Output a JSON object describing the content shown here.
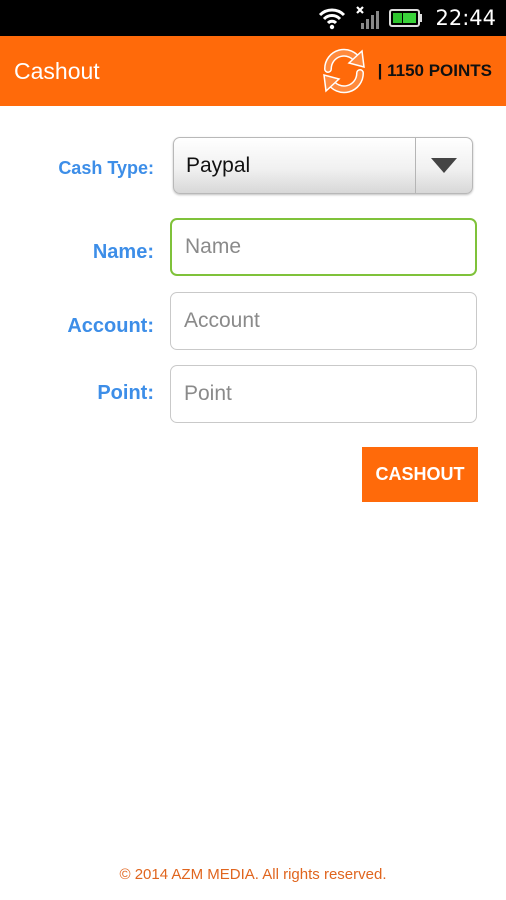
{
  "status_bar": {
    "time": "22:44",
    "icons": [
      "wifi-icon",
      "signal-icon",
      "battery-icon"
    ]
  },
  "action_bar": {
    "title": "Cashout",
    "points": "| 1150 POINTS",
    "refresh_icon": "refresh-icon",
    "color": "#ff6a0a"
  },
  "form": {
    "cash_type": {
      "label": "Cash Type:",
      "value": "Paypal"
    },
    "name": {
      "label": "Name:",
      "placeholder": "Name",
      "value": ""
    },
    "account": {
      "label": "Account:",
      "placeholder": "Account",
      "value": ""
    },
    "point": {
      "label": "Point:",
      "placeholder": "Point",
      "value": ""
    },
    "submit_label": "CASHOUT"
  },
  "footer": {
    "copyright": "© 2014 AZM MEDIA. All rights reserved."
  },
  "colors": {
    "accent": "#ff6a0a",
    "label": "#3d8ee8",
    "focus_border": "#7fc23a",
    "footer_text": "#e0651e"
  }
}
